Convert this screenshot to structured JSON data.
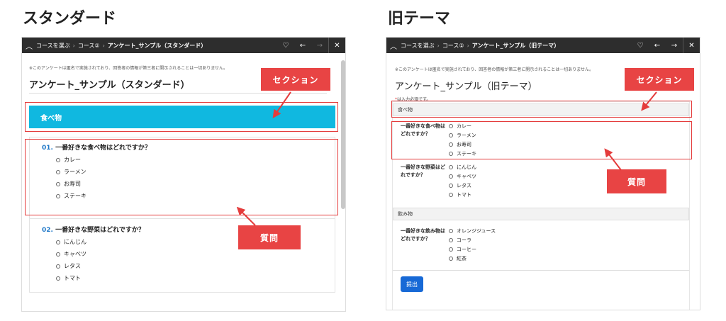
{
  "left": {
    "heading": "スタンダード",
    "breadcrumb": [
      "コースを選ぶ",
      "コース②",
      "アンケート_サンプル（スタンダード）"
    ],
    "note": "※このアンケートは匿名で実施されており、回答者の情報が第三者に開示されることは一切ありません。",
    "survey_title": "アンケート_サンプル（スタンダード）",
    "section": "食べ物",
    "questions": [
      {
        "num": "01.",
        "text": "一番好きな食べ物はどれですか？",
        "options": [
          "カレー",
          "ラーメン",
          "お寿司",
          "ステーキ"
        ]
      },
      {
        "num": "02.",
        "text": "一番好きな野菜はどれですか？",
        "options": [
          "にんじん",
          "キャベツ",
          "レタス",
          "トマト"
        ]
      }
    ]
  },
  "right": {
    "heading": "旧テーマ",
    "breadcrumb": [
      "コースを選ぶ",
      "コース②",
      "アンケート_サンプル（旧テーマ）"
    ],
    "note": "※このアンケートは匿名で実施されており、回答者の情報が第三者に開示されることは一切ありません。",
    "survey_title": "アンケート_サンプル（旧テーマ）",
    "required_note": "は入力必須です。",
    "required_star": "*",
    "sections": [
      {
        "label": "食べ物",
        "questions": [
          {
            "text": "一番好きな食べ物はどれですか？",
            "options": [
              "カレー",
              "ラーメン",
              "お寿司",
              "ステーキ"
            ]
          },
          {
            "text": "一番好きな野菜はどれですか？",
            "options": [
              "にんじん",
              "キャベツ",
              "レタス",
              "トマト"
            ]
          }
        ]
      },
      {
        "label": "飲み物",
        "questions": [
          {
            "text": "一番好きな飲み物はどれですか？",
            "options": [
              "オレンジジュース",
              "コーラ",
              "コーヒー",
              "紅茶"
            ]
          }
        ]
      }
    ],
    "submit_label": "提出"
  },
  "callouts": {
    "section": "セクション",
    "question": "質問"
  },
  "icons": {
    "up": "chevron-up-icon",
    "heart": "heart-icon",
    "back": "arrow-left-icon",
    "forward": "arrow-right-icon",
    "close": "close-icon"
  },
  "colors": {
    "section_band": "#10b8e0",
    "callout": "#e84444",
    "submit": "#1769d6",
    "topbar": "#2d2d2d"
  }
}
